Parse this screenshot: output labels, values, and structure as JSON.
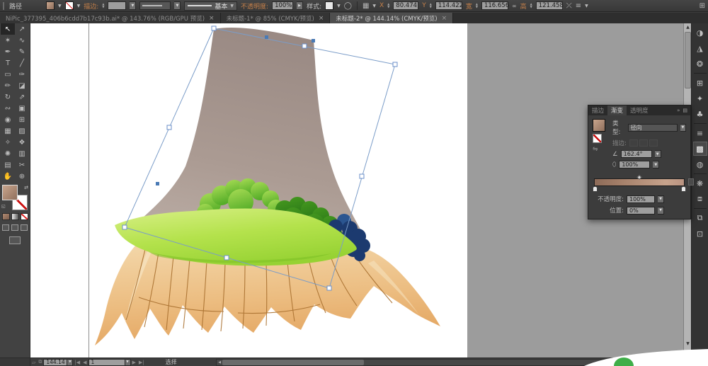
{
  "control_bar": {
    "object_label": "路径",
    "stroke_label": "描边:",
    "brush_label": "基本",
    "opacity_label": "不透明度:",
    "opacity_value": "100%",
    "style_label": "样式:",
    "transform": {
      "x_label": "X",
      "x_value": "80.474",
      "y_label": "Y",
      "y_value": "114.422",
      "w_label": "宽",
      "w_value": "116.656",
      "h_label": "高",
      "h_value": "121.458"
    }
  },
  "tabs": [
    {
      "label": "NiPic_377395_406b6cdd7b17c93b.ai* @ 143.76% (RGB/GPU 预览)",
      "active": false
    },
    {
      "label": "未标题-1* @ 85% (CMYK/预览)",
      "active": false
    },
    {
      "label": "未标题-2* @ 144.14% (CMYK/预览)",
      "active": true
    }
  ],
  "tools": [
    {
      "name": "selection",
      "glyph": "↖",
      "active": true
    },
    {
      "name": "direct-selection",
      "glyph": "↗",
      "active": false
    },
    {
      "name": "magic-wand",
      "glyph": "✶",
      "active": false
    },
    {
      "name": "lasso",
      "glyph": "∿",
      "active": false
    },
    {
      "name": "pen",
      "glyph": "✒",
      "active": false
    },
    {
      "name": "curvature",
      "glyph": "✎",
      "active": false
    },
    {
      "name": "type",
      "glyph": "T",
      "active": false
    },
    {
      "name": "line-segment",
      "glyph": "╱",
      "active": false
    },
    {
      "name": "rectangle",
      "glyph": "▭",
      "active": false
    },
    {
      "name": "paintbrush",
      "glyph": "✑",
      "active": false
    },
    {
      "name": "pencil",
      "glyph": "✏",
      "active": false
    },
    {
      "name": "eraser",
      "glyph": "◪",
      "active": false
    },
    {
      "name": "rotate",
      "glyph": "↻",
      "active": false
    },
    {
      "name": "scale",
      "glyph": "⇗",
      "active": false
    },
    {
      "name": "width",
      "glyph": "∾",
      "active": false
    },
    {
      "name": "free-transform",
      "glyph": "▣",
      "active": false
    },
    {
      "name": "shape-builder",
      "glyph": "◉",
      "active": false
    },
    {
      "name": "perspective-grid",
      "glyph": "⊞",
      "active": false
    },
    {
      "name": "mesh",
      "glyph": "▦",
      "active": false
    },
    {
      "name": "gradient",
      "glyph": "▨",
      "active": false
    },
    {
      "name": "eyedropper",
      "glyph": "✧",
      "active": false
    },
    {
      "name": "blend",
      "glyph": "❖",
      "active": false
    },
    {
      "name": "symbol-sprayer",
      "glyph": "✺",
      "active": false
    },
    {
      "name": "column-graph",
      "glyph": "▥",
      "active": false
    },
    {
      "name": "artboard",
      "glyph": "▤",
      "active": false
    },
    {
      "name": "slice",
      "glyph": "✂",
      "active": false
    },
    {
      "name": "hand",
      "glyph": "✋",
      "active": false
    },
    {
      "name": "zoom",
      "glyph": "⊕",
      "active": false
    }
  ],
  "dock_icons": [
    {
      "name": "color",
      "glyph": "◑",
      "active": false
    },
    {
      "name": "color-guide",
      "glyph": "◮",
      "active": false
    },
    {
      "name": "recolor-artwork",
      "glyph": "❂",
      "active": false
    },
    {
      "name": "swatches",
      "glyph": "⊞",
      "active": false
    },
    {
      "name": "brushes",
      "glyph": "✦",
      "active": false
    },
    {
      "name": "symbols",
      "glyph": "♣",
      "active": false
    },
    {
      "name": "stroke",
      "glyph": "≡",
      "active": false
    },
    {
      "name": "gradient",
      "glyph": "▩",
      "active": true
    },
    {
      "name": "transparency",
      "glyph": "◍",
      "active": false
    },
    {
      "name": "appearance",
      "glyph": "❋",
      "active": false
    },
    {
      "name": "graphic-styles",
      "glyph": "⧈",
      "active": false
    },
    {
      "name": "layers",
      "glyph": "⧉",
      "active": false
    },
    {
      "name": "artboards",
      "glyph": "⊡",
      "active": false
    }
  ],
  "gradient_panel": {
    "tab_stroke": "描边",
    "tab_gradient": "渐变",
    "tab_transparency": "透明度",
    "type_label": "类型:",
    "type_value": "径向",
    "stroke_label": "描边:",
    "angle_value": "162.4°",
    "aspect_value": "100%",
    "opacity_label": "不透明度:",
    "opacity_value": "100%",
    "location_label": "位置:",
    "location_value": "0%"
  },
  "status_bar": {
    "zoom_value": "144.14",
    "artboard_value": "1",
    "status_text": "选择"
  },
  "icons": {
    "dropdown": "▼",
    "stepper_up": "▲",
    "stepper_down": "▼",
    "close": "×",
    "swap": "⇄",
    "menu": "≡",
    "double_arrow": "»",
    "panel_menu": "▤",
    "link": "∞",
    "circle": "◯",
    "grid": "▦",
    "angle": "∠",
    "aspect": "⬯",
    "first": "|◀",
    "prev": "◀",
    "next": "▶",
    "last": "▶|",
    "up": "▲",
    "down": "▼",
    "left": "◀",
    "right": "▶"
  },
  "colors": {
    "ui_bar": "#3d3d3d",
    "pasteboard": "#9c9c9c",
    "accent_label": "#c5804a",
    "selection_blue": "#7a9cc8",
    "trunk_top": "#9a8a84",
    "trunk_bottom": "#bcaea6",
    "mound_light": "#d6ef83",
    "mound_dark": "#96d233",
    "bush_light": "#a8dc55",
    "bush_dark": "#2e7d19",
    "bush_navy": "#1c3a6f",
    "root_light": "#f3d6a8",
    "root_dark": "#e3a45f",
    "root_vein": "#a9702f",
    "gradient_stop_left": "#8d6b58",
    "gradient_stop_right": "#c7a38c",
    "watermark_green": "#3fae49"
  }
}
